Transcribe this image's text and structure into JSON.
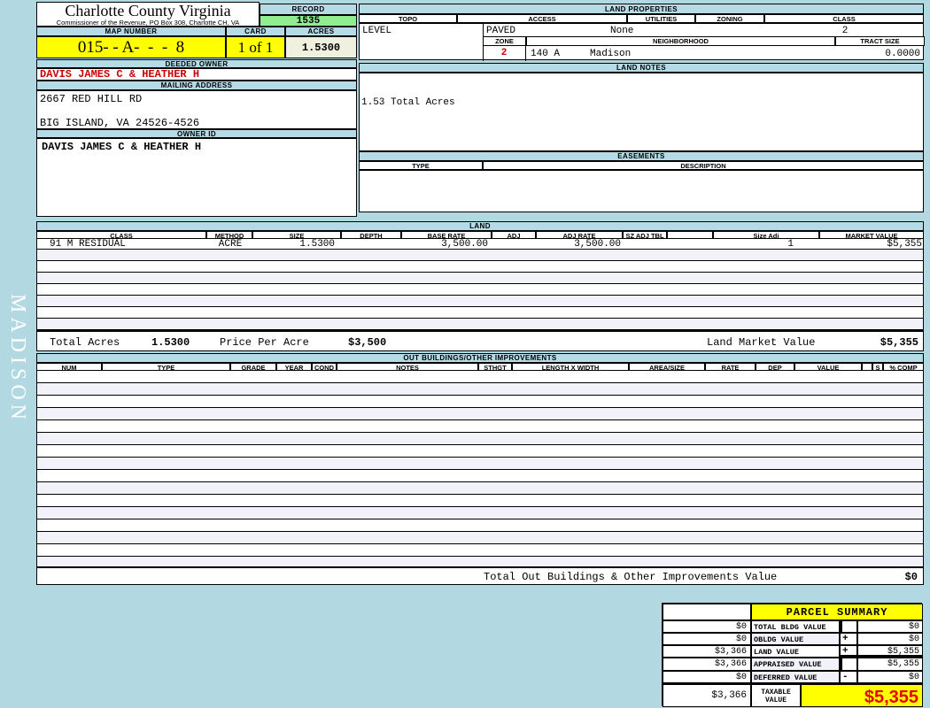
{
  "colors": {
    "page_blue": "#b2d8e2",
    "bar_blue": "#b5dbe7",
    "record_green": "#90ee90",
    "accent_yellow": "#ffff00",
    "acres_cream": "#f0f0de",
    "owner_red": "#cc0000",
    "taxable_red": "#e80000",
    "stripe_lavender": "#f2f2fa"
  },
  "header": {
    "county_title": "Charlotte County Virginia",
    "commissioner_line": "Commissioner of the Revenue, PO Box 308, Charlotte CH, VA",
    "record_label": "RECORD",
    "record_value": "1535",
    "map_label": "MAP NUMBER",
    "map_value": "015- - A-  -  -  8",
    "card_label": "CARD",
    "card_value": "1 of 1",
    "acres_label": "ACRES",
    "acres_value": "1.5300"
  },
  "owner": {
    "deeded_owner_label": "DEEDED OWNER",
    "deeded_owner": "DAVIS JAMES C & HEATHER H",
    "mailing_label": "MAILING ADDRESS",
    "address_line1": "2667 RED HILL RD",
    "address_line2": "BIG ISLAND, VA 24526-4526",
    "owner_id_label": "OWNER ID",
    "owner_id": "DAVIS JAMES C & HEATHER H"
  },
  "land_properties": {
    "title": "LAND PROPERTIES",
    "topo_label": "TOPO",
    "topo": "LEVEL",
    "access_label": "ACCESS",
    "access": "PAVED",
    "utilities_label": "UTILITIES",
    "utilities": "None",
    "zoning_label": "ZONING",
    "zoning": "",
    "class_label": "CLASS",
    "class": "2",
    "zone_label": "ZONE",
    "zone": "2",
    "neighborhood_label": "NEIGHBORHOOD",
    "neighborhood_code": "140 A",
    "neighborhood_name": "Madison",
    "tract_label": "TRACT SIZE",
    "tract_size": "0.0000"
  },
  "land_notes": {
    "title": "LAND NOTES",
    "note": "1.53 Total Acres"
  },
  "easements": {
    "title": "EASEMENTS",
    "type_label": "TYPE",
    "description_label": "DESCRIPTION"
  },
  "land_table": {
    "title": "LAND",
    "headers": [
      "CLASS",
      "METHOD",
      "SIZE",
      "DEPTH",
      "BASE RATE",
      "ADJ",
      "ADJ RATE",
      "SZ ADJ TBL",
      "",
      "Size Adj",
      "MARKET VALUE"
    ],
    "row": {
      "class": "91 M RESIDUAL",
      "method": "ACRE",
      "size": "1.5300",
      "depth": "",
      "base_rate": "3,500.00",
      "adj": "",
      "adj_rate": "3,500.00",
      "sz_adj_tbl": "",
      "size_adj": "1",
      "market_value": "$5,355"
    },
    "totals": {
      "total_acres_label": "Total Acres",
      "total_acres": "1.5300",
      "price_per_acre_label": "Price Per Acre",
      "price_per_acre": "$3,500",
      "land_market_value_label": "Land Market Value",
      "land_market_value": "$5,355"
    }
  },
  "out_buildings": {
    "title": "OUT BUILDINGS/OTHER IMPROVEMENTS",
    "headers": [
      "NUM",
      "TYPE",
      "GRADE",
      "YEAR",
      "COND",
      "NOTES",
      "STHGT",
      "LENGTH X WIDTH",
      "AREA/SIZE",
      "RATE",
      "DEP",
      "VALUE",
      "S",
      "% COMP"
    ],
    "total_label": "Total Out Buildings & Other Improvements Value",
    "total_value": "$0"
  },
  "parcel_summary": {
    "title": "PARCEL SUMMARY",
    "rows": [
      {
        "prior": "$0",
        "label": "TOTAL BLDG VALUE",
        "op": "",
        "value": "$0"
      },
      {
        "prior": "$0",
        "label": "OBLDG VALUE",
        "op": "+",
        "value": "$0"
      },
      {
        "prior": "$3,366",
        "label": "LAND VALUE",
        "op": "+",
        "value": "$5,355"
      },
      {
        "prior": "$3,366",
        "label": "APPRAISED VALUE",
        "op": "",
        "value": "$5,355"
      },
      {
        "prior": "$0",
        "label": "DEFERRED VALUE",
        "op": "-",
        "value": "$0"
      }
    ],
    "taxable": {
      "prior": "$3,366",
      "label": "TAXABLE VALUE",
      "value": "$5,355"
    }
  },
  "watermark": "MADISON"
}
